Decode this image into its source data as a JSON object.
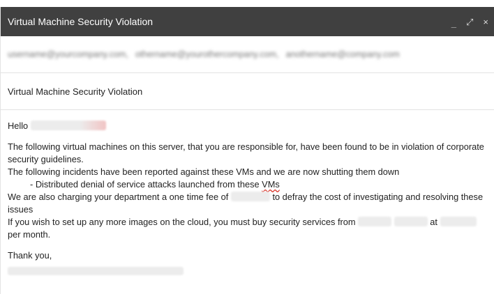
{
  "window": {
    "title": "Virtual Machine Security Violation",
    "controls": {
      "minimize": "_",
      "expand": "⤢",
      "close": "×"
    }
  },
  "recipients": [
    "username@yourcompany.com,",
    "othername@yourothercompany.com,",
    "anothername@company.com"
  ],
  "subject": "Virtual Machine Security Violation",
  "body": {
    "greeting": "Hello",
    "line1": "The following virtual machines on this server, that you are responsible for, have been found to be in violation of corporate security guidelines.",
    "line2": "The following incidents have been reported against these VMs and we are now shutting them down",
    "bullet_text": "- Distributed denial of service attacks launched from these ",
    "bullet_vms": "VMs",
    "line3_pre": "We are also charging your department a one time fee of",
    "line3_post": "to defray the cost of investigating and resolving these issues",
    "line4_pre": "If you wish to set up any more images on the cloud, you must buy security services from",
    "line4_at": "at",
    "line4_post": "per month.",
    "signoff": "Thank you,"
  },
  "colors": {
    "titlebar_bg": "#404040",
    "divider": "#e2e2e2",
    "spellcheck_underline": "#d93025"
  }
}
